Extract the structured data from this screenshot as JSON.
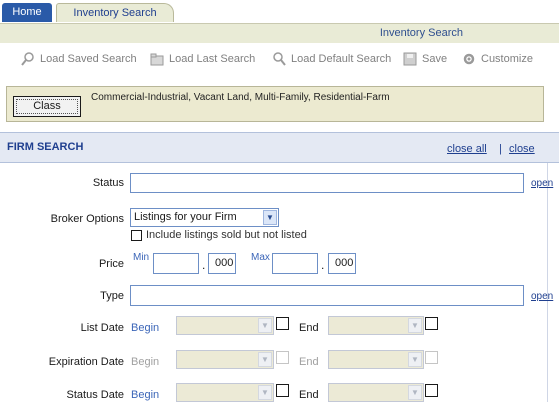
{
  "tabs": {
    "home": "Home",
    "inventory": "Inventory Search"
  },
  "titlebar": {
    "title": "Inventory Search"
  },
  "toolbar": {
    "load_saved": "Load Saved Search",
    "load_last": "Load Last Search",
    "load_default": "Load Default Search",
    "save": "Save",
    "customize": "Customize"
  },
  "class_panel": {
    "button": "Class",
    "selected": "Commercial-Industrial, Vacant Land, Multi-Family, Residential-Farm"
  },
  "firm_search": {
    "title": "FIRM SEARCH",
    "close_all": "close all",
    "separator": "|",
    "close": "close"
  },
  "form": {
    "status_label": "Status",
    "status_open": "open",
    "broker_label": "Broker Options",
    "broker_value": "Listings for your Firm",
    "include_sold": "Include listings sold but not listed",
    "price_label": "Price",
    "min_label": "Min",
    "max_label": "Max",
    "min_cents": "000",
    "max_cents": "000",
    "dot": ".",
    "type_label": "Type",
    "type_open": "open",
    "list_date_label": "List Date",
    "expiration_label": "Expiration Date",
    "status_date_label": "Status Date",
    "begin": "Begin",
    "end": "End"
  }
}
